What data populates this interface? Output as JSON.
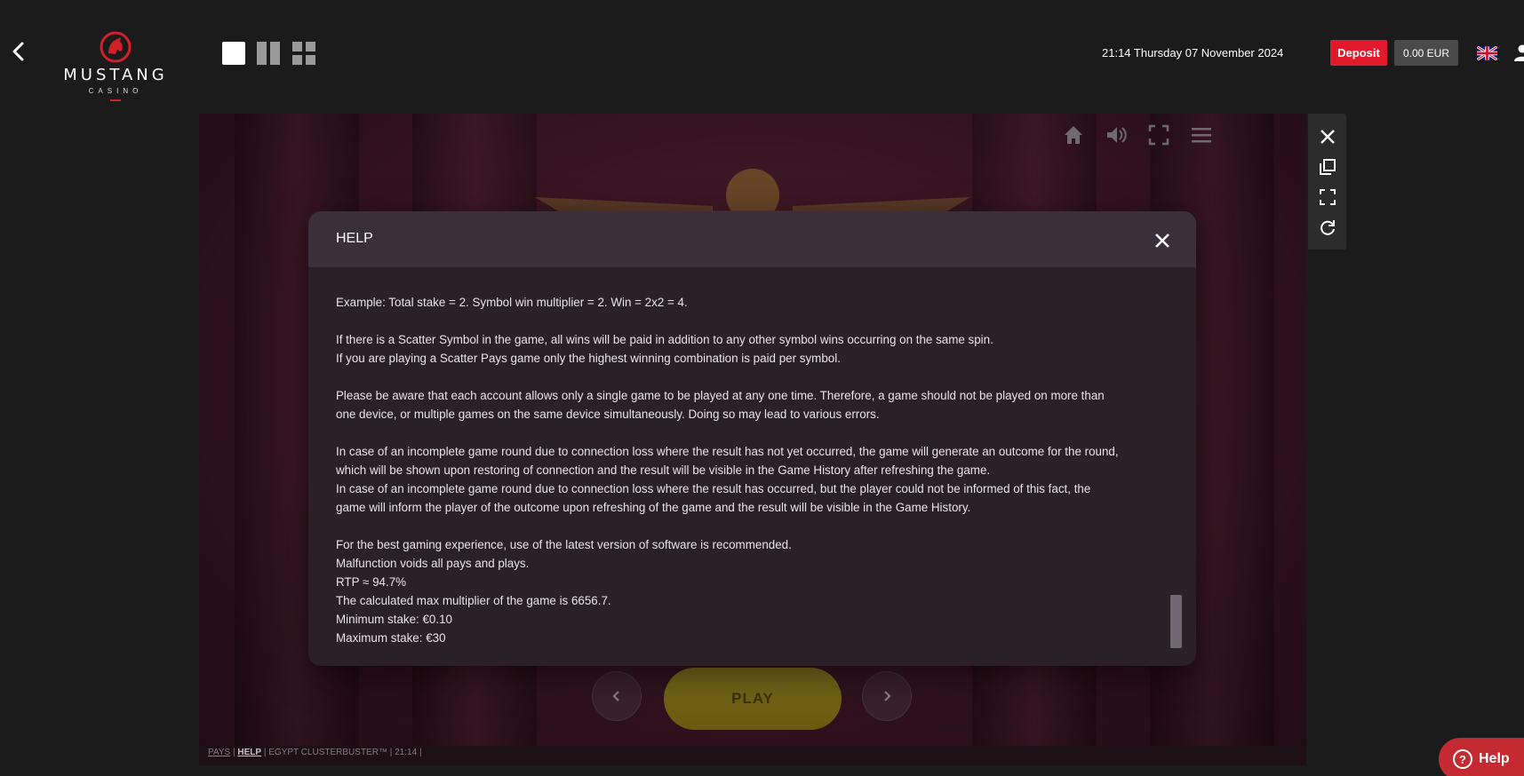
{
  "header": {
    "logo_name": "MUSTANG",
    "logo_sub": "CASINO",
    "datetime": "21:14 Thursday 07 November 2024",
    "deposit_label": "Deposit",
    "balance_label": "0.00 EUR"
  },
  "help_modal": {
    "title": "HELP",
    "paragraphs": [
      [
        "Example: Total stake = 2. Symbol win multiplier = 2. Win = 2x2 = 4."
      ],
      [
        "If there is a Scatter Symbol in the game, all wins will be paid in addition to any other symbol wins occurring on the same spin.",
        "If you are playing a Scatter Pays game only the highest winning combination is paid per symbol."
      ],
      [
        "Please be aware that each account allows only a single game to be played at any one time. Therefore, a game should not be played on more than",
        "one device, or multiple games on the same device simultaneously. Doing so may lead to various errors."
      ],
      [
        "In case of an incomplete game round due to connection loss where the result has not yet occurred, the game will generate an outcome for the round,",
        "which will be shown upon restoring of connection and the result will be visible in the Game History after refreshing the game.",
        "In case of an incomplete game round due to connection loss where the result has occurred, but the player could not be informed of this fact, the",
        "game will inform the player of the outcome upon refreshing of the game and the result will be visible in the Game History."
      ],
      [
        "For the best gaming experience, use of the latest version of software is recommended.",
        "Malfunction voids all pays and plays.",
        "RTP ≈ 94.7%",
        "The calculated max multiplier of the game is 6656.7.",
        "Minimum stake: €0.10",
        "Maximum stake: €30"
      ]
    ]
  },
  "game": {
    "play_label": "PLAY",
    "footer": {
      "pays": "PAYS",
      "help": "HELP",
      "game_name": "EGYPT CLUSTERBUSTER™",
      "time": "21:14",
      "sep": "|"
    }
  },
  "help_bubble": {
    "label": "Help",
    "icon_text": "?"
  },
  "colors": {
    "deposit": "#e11b2b",
    "brand_red": "#d0202a",
    "modal_bg": "#2a2026",
    "play_gold": "#7a6a1c"
  },
  "icons": {
    "back": "chevron-left-icon",
    "layout_single": "layout-single-icon",
    "layout_double": "layout-double-icon",
    "layout_quad": "layout-quad-icon",
    "flag": "uk-flag-icon",
    "user": "user-icon",
    "home": "home-icon",
    "sound": "sound-icon",
    "fullscreen": "fullscreen-icon",
    "menu": "menu-icon",
    "close": "close-icon",
    "copy": "copy-icon",
    "expand": "expand-icon",
    "refresh": "refresh-icon"
  }
}
